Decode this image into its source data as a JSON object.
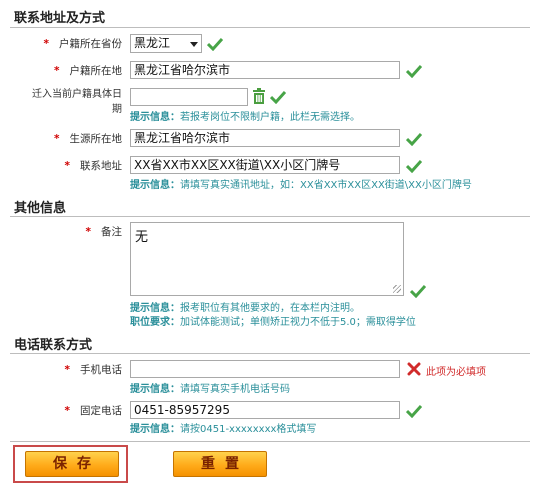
{
  "sections": {
    "contact": "联系地址及方式",
    "other": "其他信息",
    "phone": "电话联系方式"
  },
  "fields": {
    "province": {
      "label": "户籍所在省份",
      "value": "黑龙江"
    },
    "hukou": {
      "label": "户籍所在地",
      "value": "黑龙江省哈尔滨市"
    },
    "move_date": {
      "label_line1": "迁入当前户籍具体日",
      "label_line2": "期",
      "value": ""
    },
    "move_hint": {
      "tag": "提示信息：",
      "text": "若报考岗位不限制户籍，此栏无需选择。"
    },
    "origin": {
      "label": "生源所在地",
      "value": "黑龙江省哈尔滨市"
    },
    "address": {
      "label": "联系地址",
      "value": "XX省XX市XX区XX街道\\XX小区门牌号"
    },
    "address_hint": {
      "tag": "提示信息：",
      "text": "请填写真实通讯地址，如：XX省XX市XX区XX街道\\XX小区门牌号"
    },
    "remarks": {
      "label": "备注",
      "value": "无"
    },
    "remarks_hint": {
      "tag": "提示信息：",
      "text": "报考职位有其他要求的，在本栏内注明。"
    },
    "job_req": {
      "tag": "职位要求：",
      "text": "加试体能测试；单侧矫正视力不低于5.0；需取得学位"
    },
    "mobile": {
      "label": "手机电话",
      "value": "",
      "error": "此项为必填项"
    },
    "mobile_hint": {
      "tag": "提示信息：",
      "text": "请填写真实手机电话号码"
    },
    "landline": {
      "label": "固定电话",
      "value": "0451-85957295"
    },
    "landline_hint": {
      "tag": "提示信息：",
      "text": "请按0451-xxxxxxxx格式填写"
    }
  },
  "required_mark": "*",
  "buttons": {
    "save": "保存",
    "reset": "重置"
  },
  "colors": {
    "hint": "#2a8f9a",
    "error": "#d12b2b",
    "required": "#d00000",
    "button": "#ffab1a"
  }
}
